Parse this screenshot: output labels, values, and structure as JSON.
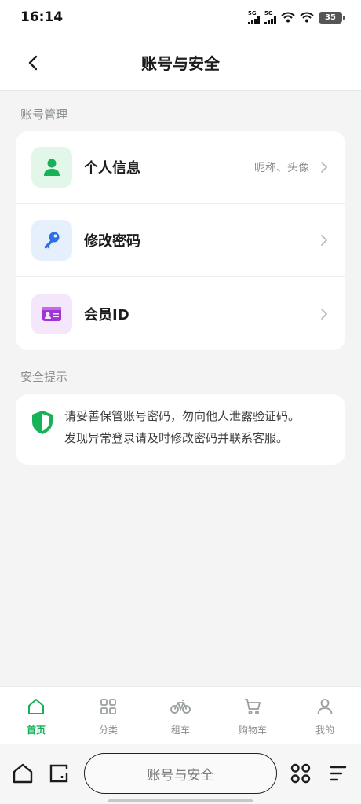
{
  "status_bar": {
    "time": "16:14",
    "signal1_label": "5G",
    "signal2_label": "5G",
    "battery": "35"
  },
  "header": {
    "title": "账号与安全",
    "back_icon": "chevron-left-icon"
  },
  "account_section": {
    "label": "账号管理",
    "items": [
      {
        "label": "个人信息",
        "hint": "昵称、头像",
        "icon": "user-icon",
        "tile_color": "#e3f6ea",
        "icon_color": "#17b257"
      },
      {
        "label": "修改密码",
        "hint": "",
        "icon": "key-icon",
        "tile_color": "#e6f0fd",
        "icon_color": "#2f6fe6"
      },
      {
        "label": "会员ID",
        "hint": "",
        "icon": "id-card-icon",
        "tile_color": "#f4e6fb",
        "icon_color": "#a234d6"
      }
    ]
  },
  "security_section": {
    "label": "安全提示",
    "tip_line1": "请妥善保管账号密码，勿向他人泄露验证码。",
    "tip_line2": "发现异常登录请及时修改密码并联系客服。",
    "icon": "shield-icon",
    "icon_color": "#17b257"
  },
  "bottom_nav": {
    "items": [
      {
        "label": "首页",
        "icon": "home-icon",
        "active": true
      },
      {
        "label": "分类",
        "icon": "grid-icon",
        "active": false
      },
      {
        "label": "租车",
        "icon": "bicycle-icon",
        "active": false
      },
      {
        "label": "购物车",
        "icon": "cart-icon",
        "active": false
      },
      {
        "label": "我的",
        "icon": "person-icon",
        "active": false
      }
    ],
    "active_color": "#15b05a"
  },
  "browser_bar": {
    "address_text": "账号与安全"
  }
}
